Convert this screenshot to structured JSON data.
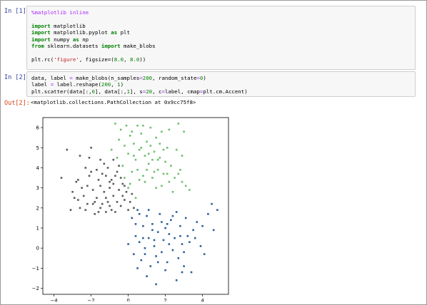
{
  "cells": [
    {
      "prompt": "In [1]:",
      "lines": [
        [
          {
            "t": "%matplotlib inline",
            "c": "mag"
          }
        ],
        [],
        [
          {
            "t": "import",
            "c": "kw"
          },
          {
            "t": " matplotlib",
            "c": ""
          }
        ],
        [
          {
            "t": "import",
            "c": "kw"
          },
          {
            "t": " matplotlib.pyplot ",
            "c": ""
          },
          {
            "t": "as",
            "c": "kw"
          },
          {
            "t": " plt",
            "c": ""
          }
        ],
        [
          {
            "t": "import",
            "c": "kw"
          },
          {
            "t": " numpy ",
            "c": ""
          },
          {
            "t": "as",
            "c": "kw"
          },
          {
            "t": " np",
            "c": ""
          }
        ],
        [
          {
            "t": "from",
            "c": "kw"
          },
          {
            "t": " sklearn.datasets ",
            "c": ""
          },
          {
            "t": "import",
            "c": "kw"
          },
          {
            "t": " make_blobs",
            "c": ""
          }
        ],
        [],
        [
          {
            "t": "plt.rc(",
            "c": ""
          },
          {
            "t": "'figure'",
            "c": "str"
          },
          {
            "t": ", figsize=(",
            "c": ""
          },
          {
            "t": "8.0",
            "c": "num"
          },
          {
            "t": ", ",
            "c": ""
          },
          {
            "t": "8.0",
            "c": "num"
          },
          {
            "t": "))",
            "c": ""
          }
        ]
      ]
    },
    {
      "prompt": "In [2]:",
      "lines": [
        [
          {
            "t": "data, label ",
            "c": ""
          },
          {
            "t": "=",
            "c": "op"
          },
          {
            "t": " make_blobs(n_samples",
            "c": ""
          },
          {
            "t": "=",
            "c": "op"
          },
          {
            "t": "200",
            "c": "num"
          },
          {
            "t": ", random_state",
            "c": ""
          },
          {
            "t": "=",
            "c": "op"
          },
          {
            "t": "0",
            "c": "num"
          },
          {
            "t": ")",
            "c": ""
          }
        ],
        [
          {
            "t": "label ",
            "c": ""
          },
          {
            "t": "=",
            "c": "op"
          },
          {
            "t": " label.reshape(",
            "c": ""
          },
          {
            "t": "200",
            "c": "num"
          },
          {
            "t": ", ",
            "c": ""
          },
          {
            "t": "1",
            "c": "num"
          },
          {
            "t": ")",
            "c": ""
          }
        ],
        [
          {
            "t": "plt.scatter(data[:,",
            "c": ""
          },
          {
            "t": "0",
            "c": "num"
          },
          {
            "t": "], data[:,",
            "c": ""
          },
          {
            "t": "1",
            "c": "num"
          },
          {
            "t": "], s",
            "c": ""
          },
          {
            "t": "=",
            "c": "op"
          },
          {
            "t": "20",
            "c": "num"
          },
          {
            "t": ", c",
            "c": ""
          },
          {
            "t": "=",
            "c": "op"
          },
          {
            "t": "label, cmap",
            "c": ""
          },
          {
            "t": "=",
            "c": "op"
          },
          {
            "t": "plt.cm.Accent)",
            "c": ""
          }
        ]
      ]
    }
  ],
  "output": {
    "prompt": "Out[2]:",
    "text": "<matplotlib.collections.PathCollection at 0x9cc75f8>"
  },
  "chart_data": {
    "type": "scatter",
    "xlim": [
      -4.6,
      5.4
    ],
    "ylim": [
      -2.3,
      6.5
    ],
    "x_ticks": [
      -4,
      -2,
      0,
      2,
      4
    ],
    "y_ticks": [
      -2,
      -1,
      0,
      1,
      2,
      3,
      4,
      5,
      6
    ],
    "grid": false,
    "series": [
      {
        "color": "#5a5a5a",
        "points": [
          [
            -3.6,
            3.5
          ],
          [
            -3.1,
            1.9
          ],
          [
            -2.9,
            2.5
          ],
          [
            -2.8,
            3.3
          ],
          [
            -2.7,
            3.4
          ],
          [
            -2.6,
            2.0
          ],
          [
            -2.5,
            3.0
          ],
          [
            -2.3,
            4.0
          ],
          [
            -2.2,
            2.2
          ],
          [
            -2.1,
            4.5
          ],
          [
            -2.0,
            3.8
          ],
          [
            -1.9,
            2.9
          ],
          [
            -1.8,
            1.7
          ],
          [
            -1.7,
            2.5
          ],
          [
            -1.6,
            1.8
          ],
          [
            -1.5,
            3.1
          ],
          [
            -1.4,
            2.2
          ],
          [
            -1.3,
            4.2
          ],
          [
            -1.2,
            3.6
          ],
          [
            -1.1,
            2.3
          ],
          [
            -1.0,
            3.0
          ],
          [
            -0.9,
            3.4
          ],
          [
            -0.8,
            2.6
          ],
          [
            -0.7,
            1.8
          ],
          [
            -0.6,
            3.8
          ],
          [
            -0.5,
            2.9
          ],
          [
            -0.4,
            2.1
          ],
          [
            -0.3,
            3.2
          ],
          [
            -0.2,
            2.4
          ],
          [
            -0.1,
            2.8
          ],
          [
            0.0,
            1.9
          ],
          [
            0.1,
            2.3
          ],
          [
            -3.0,
            2.8
          ],
          [
            -2.6,
            4.6
          ],
          [
            -2.0,
            5.0
          ],
          [
            -1.8,
            2.3
          ],
          [
            -1.5,
            4.4
          ],
          [
            -1.2,
            1.8
          ],
          [
            -0.8,
            3.2
          ],
          [
            -0.5,
            4.1
          ],
          [
            -2.4,
            2.6
          ],
          [
            -1.6,
            3.4
          ],
          [
            -1.0,
            2.1
          ],
          [
            -0.3,
            2.6
          ],
          [
            0.2,
            2.7
          ],
          [
            -3.3,
            4.9
          ],
          [
            -1.3,
            2.8
          ],
          [
            -0.7,
            3.6
          ],
          [
            -2.2,
            3.1
          ],
          [
            -1.1,
            4.0
          ],
          [
            -0.4,
            3.5
          ],
          [
            -1.9,
            2.2
          ],
          [
            -2.7,
            2.4
          ],
          [
            -0.9,
            1.9
          ],
          [
            -1.4,
            3.7
          ],
          [
            0.3,
            2.0
          ],
          [
            -0.6,
            2.3
          ],
          [
            -1.7,
            3.9
          ],
          [
            -2.3,
            1.9
          ],
          [
            -0.2,
            3.1
          ],
          [
            -1.0,
            3.3
          ],
          [
            -1.5,
            2.0
          ],
          [
            -0.8,
            4.4
          ],
          [
            -2.1,
            3.6
          ],
          [
            -1.2,
            2.5
          ]
        ]
      },
      {
        "color": "#6fbf6f",
        "points": [
          [
            -0.9,
            4.9
          ],
          [
            -0.7,
            6.2
          ],
          [
            -0.6,
            4.5
          ],
          [
            -0.5,
            5.4
          ],
          [
            -0.4,
            5.9
          ],
          [
            -0.3,
            4.1
          ],
          [
            -0.2,
            5.1
          ],
          [
            -0.1,
            6.1
          ],
          [
            0.0,
            4.7
          ],
          [
            0.1,
            5.6
          ],
          [
            0.2,
            3.8
          ],
          [
            0.3,
            5.2
          ],
          [
            0.4,
            4.4
          ],
          [
            0.5,
            6.1
          ],
          [
            0.6,
            4.9
          ],
          [
            0.7,
            5.7
          ],
          [
            0.8,
            3.6
          ],
          [
            0.9,
            4.6
          ],
          [
            1.0,
            5.3
          ],
          [
            1.1,
            4.2
          ],
          [
            1.2,
            6.0
          ],
          [
            1.3,
            3.5
          ],
          [
            1.4,
            4.8
          ],
          [
            1.5,
            5.5
          ],
          [
            1.6,
            3.9
          ],
          [
            1.7,
            4.5
          ],
          [
            1.8,
            5.8
          ],
          [
            1.9,
            3.7
          ],
          [
            2.0,
            4.3
          ],
          [
            2.1,
            5.0
          ],
          [
            2.2,
            3.3
          ],
          [
            2.3,
            4.1
          ],
          [
            2.5,
            3.5
          ],
          [
            2.6,
            4.9
          ],
          [
            2.7,
            6.2
          ],
          [
            2.8,
            3.9
          ],
          [
            3.0,
            5.8
          ],
          [
            3.1,
            3.1
          ],
          [
            0.1,
            3.2
          ],
          [
            0.5,
            3.9
          ],
          [
            -0.2,
            3.5
          ],
          [
            0.9,
            3.3
          ],
          [
            1.2,
            5.1
          ],
          [
            1.6,
            4.4
          ],
          [
            2.2,
            5.9
          ],
          [
            2.9,
            4.6
          ],
          [
            1.8,
            3.1
          ],
          [
            0.3,
            4.6
          ],
          [
            1.4,
            3.8
          ],
          [
            0.7,
            5.0
          ],
          [
            2.4,
            2.8
          ],
          [
            1.1,
            4.7
          ],
          [
            0.6,
            3.4
          ],
          [
            1.9,
            4.9
          ],
          [
            2.7,
            3.7
          ],
          [
            1.5,
            3.0
          ],
          [
            0.2,
            5.8
          ],
          [
            2.1,
            3.7
          ],
          [
            1.3,
            4.4
          ],
          [
            0.4,
            2.5
          ],
          [
            3.3,
            2.9
          ],
          [
            0.8,
            6.1
          ],
          [
            1.7,
            5.2
          ],
          [
            2.9,
            3.3
          ],
          [
            1.0,
            3.9
          ],
          [
            0.0,
            3.0
          ]
        ]
      },
      {
        "color": "#2f5f9a",
        "points": [
          [
            0.0,
            0.2
          ],
          [
            0.2,
            1.5
          ],
          [
            0.3,
            -0.3
          ],
          [
            0.4,
            0.6
          ],
          [
            0.5,
            1.9
          ],
          [
            0.6,
            0.3
          ],
          [
            0.7,
            -0.6
          ],
          [
            0.8,
            1.1
          ],
          [
            0.9,
            0.0
          ],
          [
            1.0,
            1.6
          ],
          [
            1.1,
            0.5
          ],
          [
            1.2,
            -0.9
          ],
          [
            1.3,
            1.2
          ],
          [
            1.4,
            0.1
          ],
          [
            1.5,
            -0.4
          ],
          [
            1.6,
            0.8
          ],
          [
            1.7,
            1.7
          ],
          [
            1.8,
            -0.2
          ],
          [
            1.9,
            0.4
          ],
          [
            2.0,
            1.0
          ],
          [
            2.1,
            -0.7
          ],
          [
            2.2,
            0.7
          ],
          [
            2.3,
            1.4
          ],
          [
            2.4,
            -0.1
          ],
          [
            2.5,
            0.5
          ],
          [
            2.6,
            1.8
          ],
          [
            2.7,
            -0.5
          ],
          [
            2.8,
            1.1
          ],
          [
            2.9,
            0.2
          ],
          [
            3.0,
            -0.9
          ],
          [
            3.1,
            1.5
          ],
          [
            3.2,
            0.6
          ],
          [
            3.4,
            -1.2
          ],
          [
            3.5,
            0.9
          ],
          [
            3.7,
            1.3
          ],
          [
            3.9,
            0.1
          ],
          [
            4.1,
            -0.3
          ],
          [
            4.3,
            1.7
          ],
          [
            4.5,
            2.2
          ],
          [
            4.6,
            0.9
          ],
          [
            4.8,
            1.9
          ],
          [
            0.5,
            -1.0
          ],
          [
            1.0,
            -1.4
          ],
          [
            1.5,
            -1.8
          ],
          [
            2.0,
            -1.1
          ],
          [
            2.6,
            -1.6
          ],
          [
            3.0,
            -0.2
          ],
          [
            1.3,
            0.9
          ],
          [
            0.8,
            0.5
          ],
          [
            1.8,
            1.3
          ],
          [
            2.2,
            0.2
          ],
          [
            2.8,
            0.6
          ],
          [
            0.4,
            1.2
          ],
          [
            1.1,
            1.9
          ],
          [
            3.3,
            0.3
          ],
          [
            2.4,
            1.6
          ],
          [
            0.9,
            -0.3
          ],
          [
            1.6,
            -0.7
          ],
          [
            2.1,
            1.2
          ],
          [
            3.6,
            0.5
          ],
          [
            4.0,
            1.1
          ],
          [
            0.6,
            1.7
          ],
          [
            2.9,
            -1.2
          ],
          [
            1.4,
            0.4
          ]
        ]
      }
    ]
  }
}
